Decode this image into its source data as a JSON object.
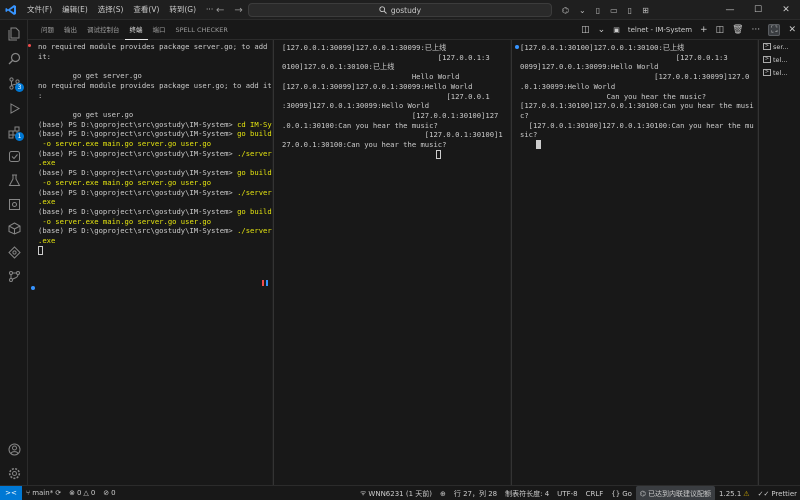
{
  "menu": [
    "文件(F)",
    "编辑(E)",
    "选择(S)",
    "查看(V)",
    "转到(G)"
  ],
  "search": {
    "text": "gostudy"
  },
  "titlebar_icons": [
    "copilot-icon",
    "chevron-down-icon",
    "layout-sidebar-icon",
    "layout-panel-icon",
    "layout-sidebar-right-icon",
    "layout-customize-icon"
  ],
  "panel": {
    "tabs": [
      "问题",
      "输出",
      "调试控制台",
      "终端",
      "端口",
      "SPELL CHECKER"
    ],
    "active_tab": 3,
    "terminal_name": "telnet - IM-System"
  },
  "terminal1": {
    "lines": [
      {
        "t": "no required module provides package server.go; to add"
      },
      {
        "t": "it:"
      },
      {
        "t": ""
      },
      {
        "t": "        go get server.go"
      },
      {
        "t": "no required module provides package user.go; to add it"
      },
      {
        "t": ":"
      },
      {
        "t": ""
      },
      {
        "t": "        go get user.go"
      },
      {
        "p": "(base) PS D:\\goproject\\src\\gostudy\\IM-System> ",
        "c": "cd IM-System"
      },
      {
        "p": "(base) PS D:\\goproject\\src\\gostudy\\IM-System> ",
        "c": "go build"
      },
      {
        "p": " ",
        "c": "-o server.exe main.go server.go user.go"
      },
      {
        "p": "(base) PS D:\\goproject\\src\\gostudy\\IM-System> ",
        "c": "./server"
      },
      {
        "p": "",
        "c": ".exe"
      },
      {
        "p": "(base) PS D:\\goproject\\src\\gostudy\\IM-System> ",
        "c": "go build"
      },
      {
        "p": " ",
        "c": "-o server.exe main.go server.go user.go"
      },
      {
        "p": "(base) PS D:\\goproject\\src\\gostudy\\IM-System> ",
        "c": "./server"
      },
      {
        "p": "",
        "c": ".exe"
      },
      {
        "p": "(base) PS D:\\goproject\\src\\gostudy\\IM-System> ",
        "c": "go build"
      },
      {
        "p": " ",
        "c": "-o server.exe main.go server.go user.go"
      },
      {
        "p": "(base) PS D:\\goproject\\src\\gostudy\\IM-System> ",
        "c": "./server"
      },
      {
        "p": "",
        "c": ".exe"
      }
    ]
  },
  "terminal2": {
    "lines": [
      "[127.0.0.1:30099]127.0.0.1:30099:已上线",
      "                                    [127.0.0.1:3",
      "0100]127.0.0.1:30100:已上线",
      "                              Hello World",
      "[127.0.0.1:30099]127.0.0.1:30099:Hello World",
      "                                      [127.0.0.1",
      ":30099]127.0.0.1:30099:Hello World",
      "                              [127.0.0.1:30100]127",
      ".0.0.1:30100:Can you hear the music?",
      "                                 [127.0.0.1:30100]1",
      "27.0.0.1:30100:Can you hear the music?"
    ]
  },
  "terminal3": {
    "lines": [
      "[127.0.0.1:30100]127.0.0.1:30100:已上线",
      "                                    [127.0.0.1:3",
      "0099]127.0.0.1:30099:Hello World",
      "                               [127.0.0.1:30099]127.0",
      ".0.1:30099:Hello World",
      "                    Can you hear the music?",
      "[127.0.0.1:30100]127.0.0.1:30100:Can you hear the musi",
      "c?",
      "  [127.0.0.1:30100]127.0.0.1:30100:Can you hear the mu",
      "sic?"
    ]
  },
  "termlist": [
    "ser...",
    "tel...",
    "tel..."
  ],
  "status": {
    "branch": "main*",
    "errors": "0",
    "warnings": "0",
    "problems": "0",
    "wifi": "WNN6231 (1 天前)",
    "position": "行 27，列 28",
    "tabsize": "制表符长度: 4",
    "encoding": "UTF-8",
    "eol": "CRLF",
    "language": "Go",
    "sync": "已达到内联建议配额",
    "version": "1.25.1",
    "prettier": "Prettier"
  },
  "colors": {
    "accent": "#0078d4",
    "command": "#e5e510",
    "background": "#181818"
  }
}
